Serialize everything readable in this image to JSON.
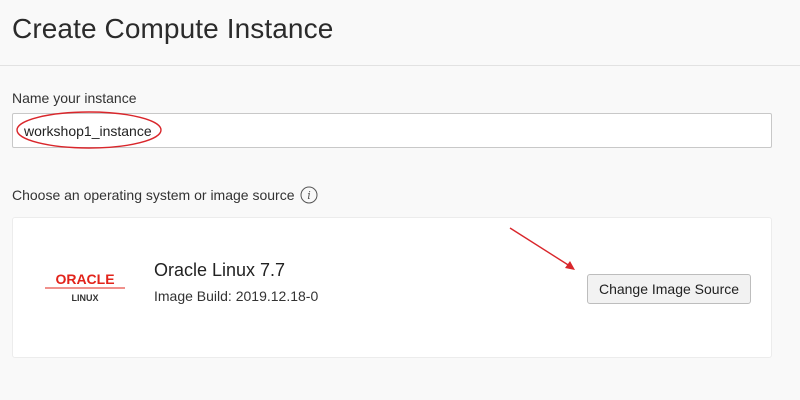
{
  "page": {
    "title": "Create Compute Instance"
  },
  "name_section": {
    "label": "Name your instance",
    "value": "workshop1_instance"
  },
  "image_section": {
    "label": "Choose an operating system or image source",
    "info_icon": "info-icon",
    "logo": {
      "brand": "ORACLE",
      "sub": "LINUX",
      "color": "#e2231a"
    },
    "image_name": "Oracle Linux 7.7",
    "image_build": "Image Build: 2019.12.18-0",
    "change_button": "Change Image Source"
  },
  "annotations": {
    "color": "#d9262b"
  }
}
